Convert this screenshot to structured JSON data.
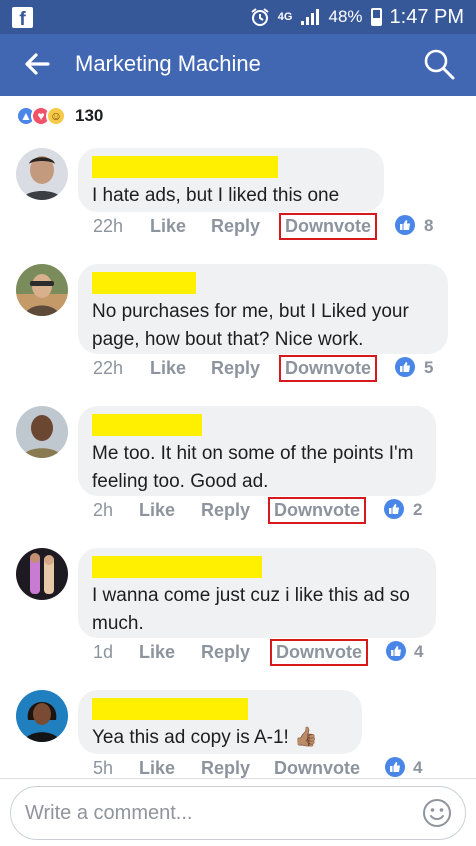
{
  "status_bar": {
    "battery": "48%",
    "time": "1:47 PM",
    "network": "4G"
  },
  "app_bar": {
    "title": "Marketing Machine"
  },
  "reactions": {
    "count": "130"
  },
  "comments": [
    {
      "text": "I hate ads, but I liked this one",
      "time": "22h",
      "like": "Like",
      "reply": "Reply",
      "downvote": "Downvote",
      "likes": "8"
    },
    {
      "text": "No purchases for me, but I Liked your page, how bout that? Nice work.",
      "time": "22h",
      "like": "Like",
      "reply": "Reply",
      "downvote": "Downvote",
      "likes": "5"
    },
    {
      "text": "Me too. It hit on some of the points I'm feeling too. Good ad.",
      "time": "2h",
      "like": "Like",
      "reply": "Reply",
      "downvote": "Downvote",
      "likes": "2"
    },
    {
      "text": "I wanna come just cuz i like this ad so much.",
      "time": "1d",
      "like": "Like",
      "reply": "Reply",
      "downvote": "Downvote",
      "likes": "4"
    },
    {
      "text": "Yea this ad copy is A-1! 👍🏽",
      "time": "5h",
      "like": "Like",
      "reply": "Reply",
      "downvote": "Downvote",
      "likes": "4"
    }
  ],
  "composer": {
    "placeholder": "Write a comment..."
  },
  "colors": {
    "header": "#4267b2",
    "status_bar": "#365899",
    "bubble": "#f0f1f3",
    "highlight_box": "#d7181d",
    "redaction": "#ffef00",
    "like_blue": "#4a86e8"
  }
}
